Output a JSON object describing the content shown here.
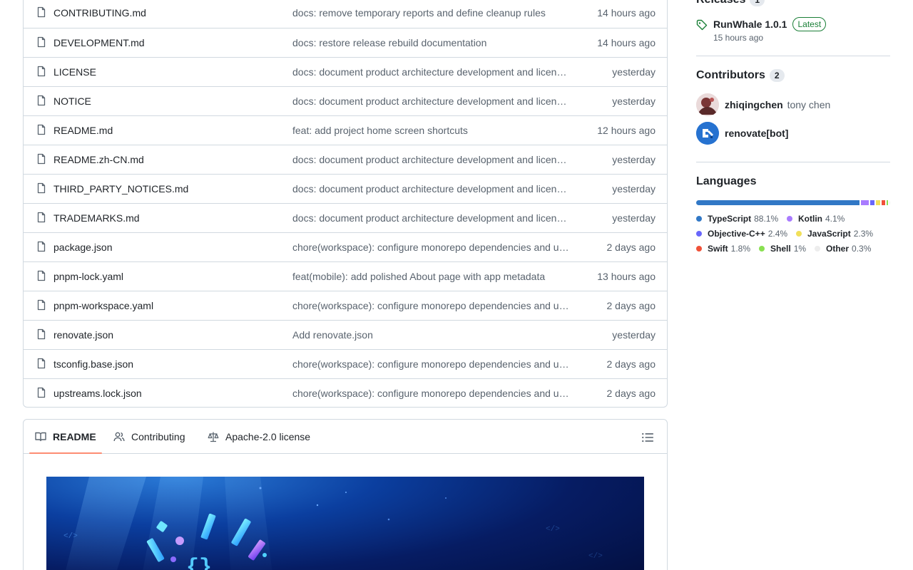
{
  "files": [
    {
      "name": "CONTRIBUTING.md",
      "message": "docs: remove temporary reports and define cleanup rules",
      "time": "14 hours ago"
    },
    {
      "name": "DEVELOPMENT.md",
      "message": "docs: restore release rebuild documentation",
      "time": "14 hours ago"
    },
    {
      "name": "LICENSE",
      "message": "docs: document product architecture development and licensing",
      "time": "yesterday"
    },
    {
      "name": "NOTICE",
      "message": "docs: document product architecture development and licensing",
      "time": "yesterday"
    },
    {
      "name": "README.md",
      "message": "feat: add project home screen shortcuts",
      "time": "12 hours ago"
    },
    {
      "name": "README.zh-CN.md",
      "message": "docs: document product architecture development and licensing",
      "time": "yesterday"
    },
    {
      "name": "THIRD_PARTY_NOTICES.md",
      "message": "docs: document product architecture development and licensing",
      "time": "yesterday"
    },
    {
      "name": "TRADEMARKS.md",
      "message": "docs: document product architecture development and licensing",
      "time": "yesterday"
    },
    {
      "name": "package.json",
      "message": "chore(workspace): configure monorepo dependencies and upstreams",
      "time": "2 days ago"
    },
    {
      "name": "pnpm-lock.yaml",
      "message": "feat(mobile): add polished About page with app metadata",
      "time": "13 hours ago"
    },
    {
      "name": "pnpm-workspace.yaml",
      "message": "chore(workspace): configure monorepo dependencies and upstreams",
      "time": "2 days ago"
    },
    {
      "name": "renovate.json",
      "message": "Add renovate.json",
      "time": "yesterday"
    },
    {
      "name": "tsconfig.base.json",
      "message": "chore(workspace): configure monorepo dependencies and upstreams",
      "time": "2 days ago"
    },
    {
      "name": "upstreams.lock.json",
      "message": "chore(workspace): configure monorepo dependencies and upstreams",
      "time": "2 days ago"
    }
  ],
  "readme_tabs": {
    "readme": "README",
    "contributing": "Contributing",
    "license": "Apache-2.0 license"
  },
  "sidebar": {
    "releases": {
      "title": "Releases",
      "count": "1",
      "name": "RunWhale 1.0.1",
      "badge": "Latest",
      "time": "15 hours ago"
    },
    "contributors": {
      "title": "Contributors",
      "count": "2",
      "people": [
        {
          "login": "zhiqingchen",
          "name": "tony chen"
        },
        {
          "login": "renovate[bot]",
          "name": ""
        }
      ]
    },
    "languages": {
      "title": "Languages",
      "items": [
        {
          "name": "TypeScript",
          "pct": "88.1%",
          "value": 88.1,
          "color": "#3178c6"
        },
        {
          "name": "Kotlin",
          "pct": "4.1%",
          "value": 4.1,
          "color": "#a97bff"
        },
        {
          "name": "Objective-C++",
          "pct": "2.4%",
          "value": 2.4,
          "color": "#6866fb"
        },
        {
          "name": "JavaScript",
          "pct": "2.3%",
          "value": 2.3,
          "color": "#f1e05a"
        },
        {
          "name": "Swift",
          "pct": "1.8%",
          "value": 1.8,
          "color": "#f05138"
        },
        {
          "name": "Shell",
          "pct": "1%",
          "value": 1.0,
          "color": "#89e051"
        },
        {
          "name": "Other",
          "pct": "0.3%",
          "value": 0.3,
          "color": "#ededed"
        }
      ]
    }
  },
  "icons": {
    "file": "file-icon",
    "book": "book-icon",
    "people": "people-icon",
    "law": "law-icon",
    "list": "list-unordered-icon",
    "tag": "tag-icon"
  }
}
